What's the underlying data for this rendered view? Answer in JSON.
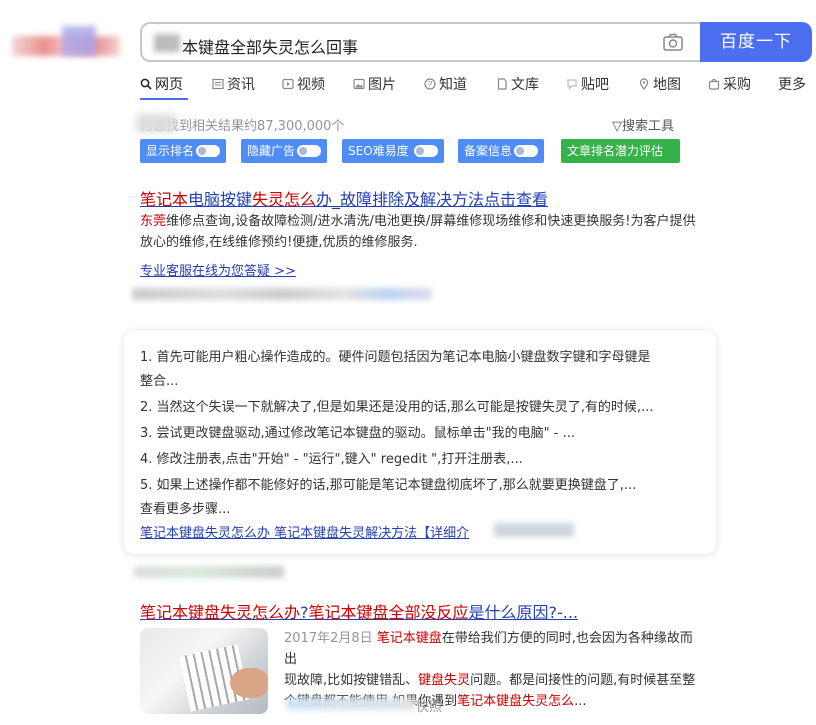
{
  "search": {
    "query": "本键盘全部失灵怎么回事",
    "button_label": "百度一下"
  },
  "tabs": [
    {
      "label": "网页",
      "icon": "search-icon"
    },
    {
      "label": "资讯",
      "icon": "news-icon"
    },
    {
      "label": "视频",
      "icon": "video-icon"
    },
    {
      "label": "图片",
      "icon": "image-icon"
    },
    {
      "label": "知道",
      "icon": "question-icon"
    },
    {
      "label": "文库",
      "icon": "document-icon"
    },
    {
      "label": "贴吧",
      "icon": "tieba-icon"
    },
    {
      "label": "地图",
      "icon": "map-icon"
    },
    {
      "label": "采购",
      "icon": "purchase-icon"
    },
    {
      "label": "更多",
      "icon": ""
    }
  ],
  "results_info": {
    "count_text": "为您找到相关结果约87,300,000个",
    "tools_label": "搜索工具"
  },
  "seo_tools": [
    {
      "label": "显示排名"
    },
    {
      "label": "隐藏广告"
    },
    {
      "label": "SEO难易度"
    },
    {
      "label": "备案信息"
    }
  ],
  "seo_green_label": "文章排名潜力评估 >",
  "result1": {
    "title_hl1": "笔记本",
    "title_mid1": "电脑按键",
    "title_hl2": "失灵怎么",
    "title_rest": "办_故障排除及解决方法点击查看",
    "text_hl": "东莞",
    "text_line1": "维修点查询,设备故障检测/进水清洗/电池更换/屏幕维修现场维修和快速更换服务!为客户提供",
    "text_line2": "放心的维修,在线维修预约!便捷,优质的维修服务.",
    "link": "专业客服在线为您答疑 >>"
  },
  "card": {
    "lines": [
      "1. 首先可能用户粗心操作造成的。硬件问题包括因为笔记本电脑小键盘数字键和字母键是",
      "整合...",
      "2. 当然这个失误一下就解决了,但是如果还是没用的话,那么可能是按键失灵了,有的时候,...",
      "3. 尝试更改键盘驱动,通过修改笔记本键盘的驱动。鼠标单击\"我的电脑\" - ...",
      "4. 修改注册表,点击\"开始\" - \"运行\",键入\" regedit \",打开注册表,...",
      "5. 如果上述操作都不能修好的话,那可能是笔记本键盘彻底坏了,那么就要更换键盘了,...",
      "查看更多步骤..."
    ],
    "link": "笔记本键盘失灵怎么办 笔记本键盘失灵解决方法【详细介"
  },
  "result2": {
    "title_hl1": "笔记本键盘失灵怎么办",
    "title_mid": "?",
    "title_hl2": "笔记本键盘全部没反应",
    "title_rest": "是什么原因?-...",
    "date": "2017年2月8日",
    "text_hl1": "笔记本键盘",
    "text_1": "在带给我们方便的同时,也会因为各种缘故而出",
    "text_2a": "现故障,比如按键错乱、",
    "text_hl2": "键盘失灵",
    "text_2b": "问题。都是间接性的问题,有时候甚至整",
    "text_3a": "个键盘都不能使用,如果你遇到",
    "text_hl3": "笔记本键盘失灵怎么",
    "text_3b": "...",
    "footer_tail": "快照"
  },
  "colors": {
    "accent": "#4e6ef2",
    "link": "#2440b3",
    "highlight": "#cc0000",
    "seo_blue": "#4e8df5",
    "seo_green": "#35b34a"
  }
}
